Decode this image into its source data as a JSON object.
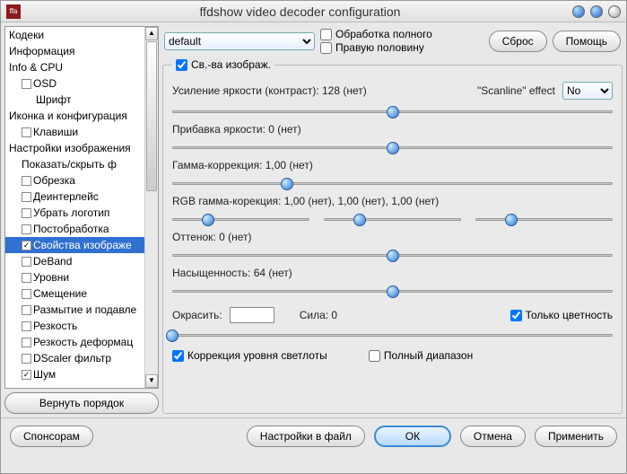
{
  "window": {
    "title": "ffdshow video decoder configuration",
    "appicon": "ffa"
  },
  "sidebar": {
    "items": [
      {
        "label": "Кодеки",
        "indent": 0,
        "cb": null
      },
      {
        "label": "Информация",
        "indent": 0,
        "cb": null
      },
      {
        "label": "Info & CPU",
        "indent": 0,
        "cb": null
      },
      {
        "label": "OSD",
        "indent": 1,
        "cb": false
      },
      {
        "label": "Шрифт",
        "indent": 2,
        "cb": null
      },
      {
        "label": "Иконка и конфигурация",
        "indent": 0,
        "cb": null
      },
      {
        "label": "Клавиши",
        "indent": 1,
        "cb": false
      },
      {
        "label": "Настройки изображения",
        "indent": 0,
        "cb": null
      },
      {
        "label": "Показать/скрыть ф",
        "indent": 1,
        "cb": null
      },
      {
        "label": "Обрезка",
        "indent": 1,
        "cb": false
      },
      {
        "label": "Деинтерлейс",
        "indent": 1,
        "cb": false
      },
      {
        "label": "Убрать логотип",
        "indent": 1,
        "cb": false
      },
      {
        "label": "Постобработка",
        "indent": 1,
        "cb": false
      },
      {
        "label": "Свойства изображе",
        "indent": 1,
        "cb": true,
        "selected": true
      },
      {
        "label": "DeBand",
        "indent": 1,
        "cb": false
      },
      {
        "label": "Уровни",
        "indent": 1,
        "cb": false
      },
      {
        "label": "Смещение",
        "indent": 1,
        "cb": false
      },
      {
        "label": "Размытие и подавле",
        "indent": 1,
        "cb": false
      },
      {
        "label": "Резкость",
        "indent": 1,
        "cb": false
      },
      {
        "label": "Резкость деформац",
        "indent": 1,
        "cb": false
      },
      {
        "label": "DScaler фильтр",
        "indent": 1,
        "cb": false
      },
      {
        "label": "Шум",
        "indent": 1,
        "cb": true
      }
    ],
    "resetOrder": "Вернуть порядок"
  },
  "top": {
    "preset": "default",
    "fullProcess": "Обработка полного",
    "rightHalf": "Правую половину",
    "reset": "Сброс",
    "help": "Помощь"
  },
  "group": {
    "legend": "Св.-ва изображ.",
    "contrast": "Усиление яркости (контраст): 128 (нет)",
    "scanlineLabel": "\"Scanline\" effect",
    "scanlineValue": "No",
    "brightness": "Прибавка яркости: 0 (нет)",
    "gamma": "Гамма-коррекция: 1,00 (нет)",
    "rgbGamma": "RGB гамма-корекция: 1,00 (нет), 1,00 (нет), 1,00 (нет)",
    "hue": "Оттенок: 0 (нет)",
    "saturation": "Насыщенность: 64 (нет)",
    "colorize": "Окрасить:",
    "strength": "Сила: 0",
    "chromaOnly": "Только цветность",
    "lumaCorrection": "Коррекция уровня светлоты",
    "fullRange": "Полный диапазон"
  },
  "bottom": {
    "donate": "Спонсорам",
    "export": "Настройки в файл",
    "ok": "ОК",
    "cancel": "Отмена",
    "apply": "Применить"
  }
}
